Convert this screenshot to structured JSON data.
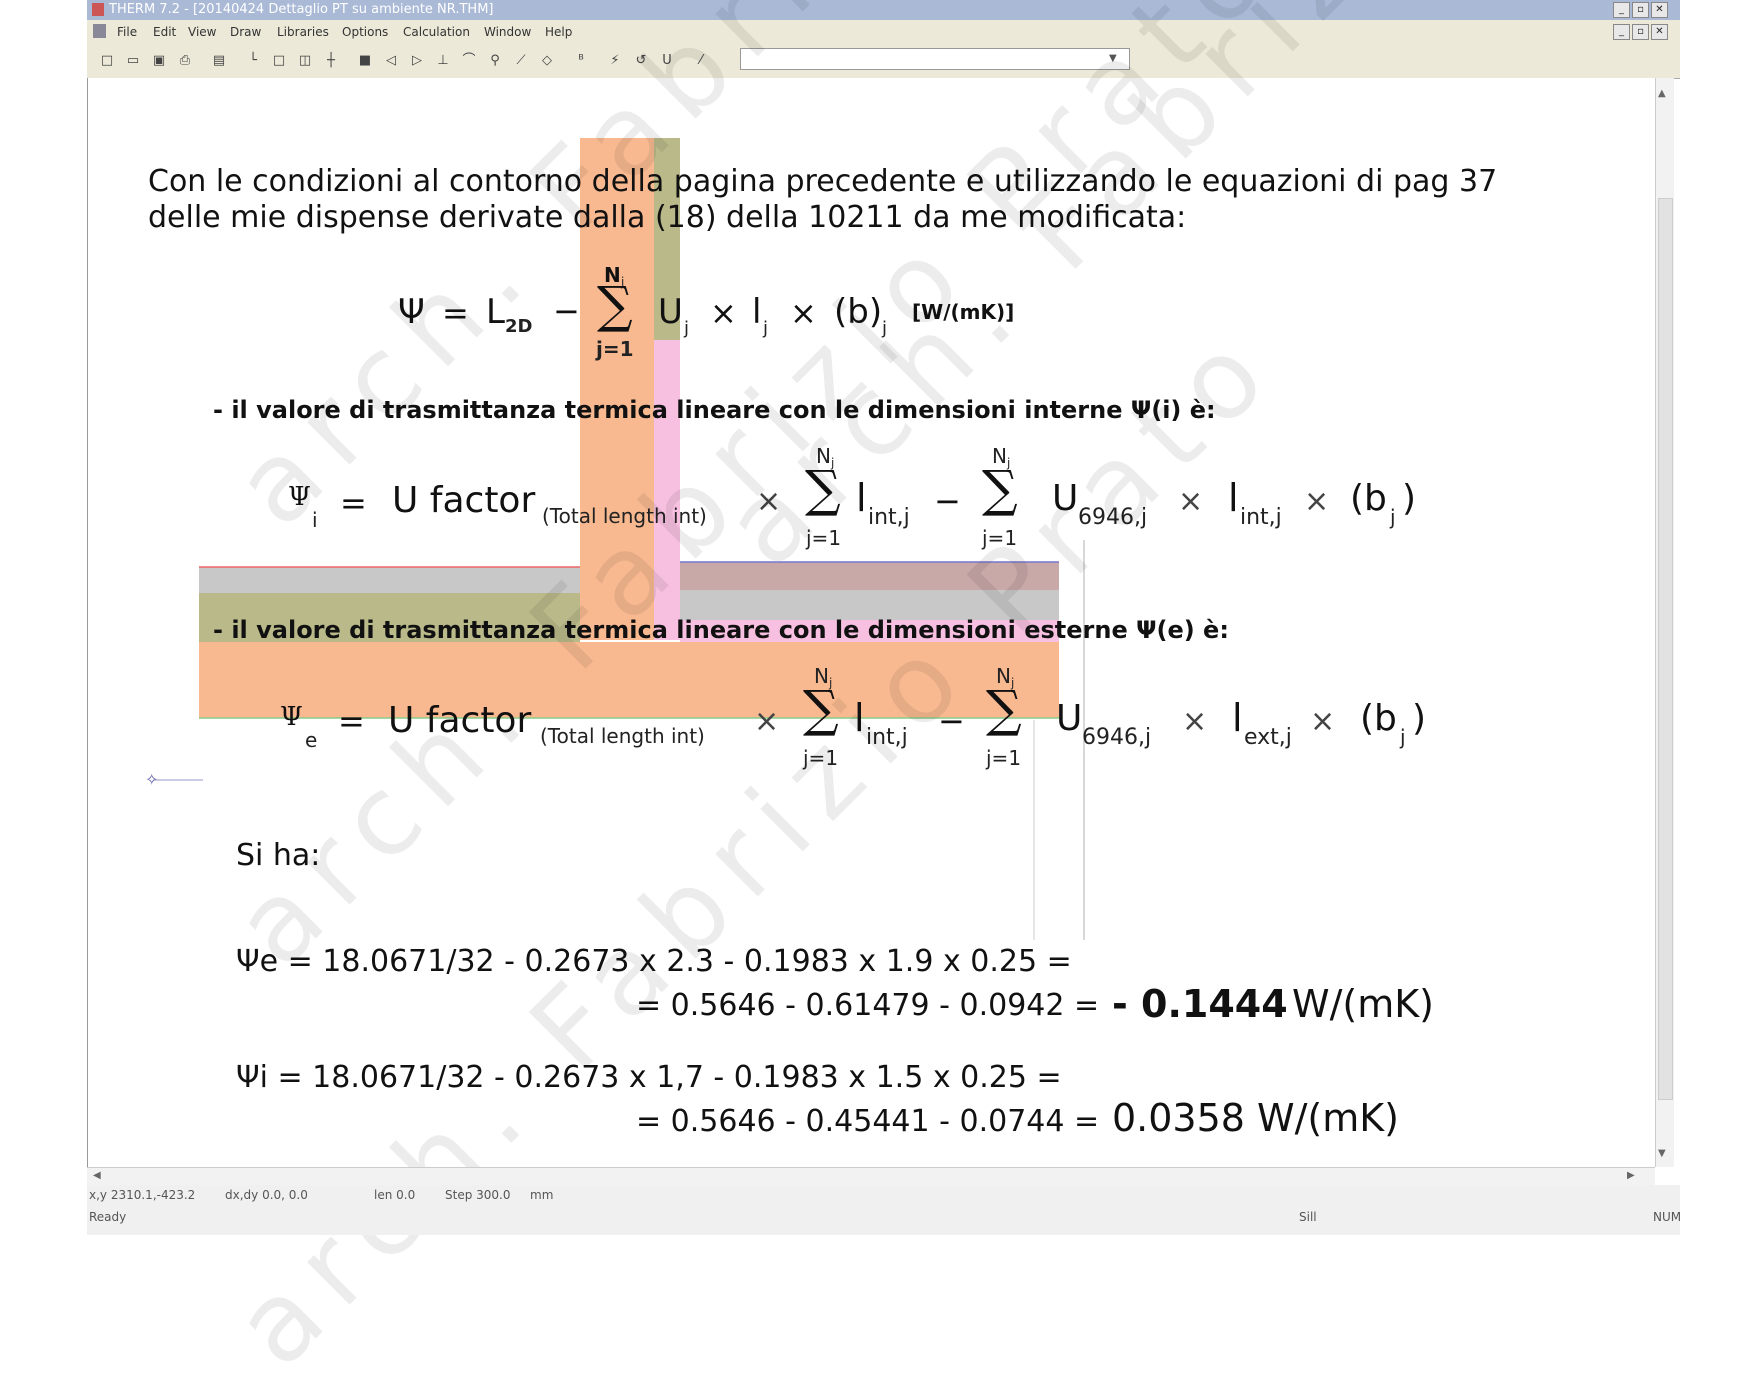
{
  "window": {
    "title": "THERM 7.2 - [20140424 Dettaglio PT su ambiente NR.THM]"
  },
  "menu": [
    "File",
    "Edit",
    "View",
    "Draw",
    "Libraries",
    "Options",
    "Calculation",
    "Window",
    "Help"
  ],
  "slide": {
    "intro_line1": "Con le condizioni al contorno della pagina precedente e utilizzando le equazioni di pag 37",
    "intro_line2": "delle mie dispense derivate dalla (18) della 10211 da me modificata:",
    "eq_main": {
      "psi": "Ψ",
      "eq": "=",
      "L": "L",
      "L_sub": "2D",
      "minus": "−",
      "sum_top": "N",
      "sum_top_sub": "j",
      "sum_bottom": "j=1",
      "term": "U",
      "term_sub": "j",
      "times": "×",
      "l": "l",
      "l_sub": "j",
      "b": "(b)",
      "b_sub": "j",
      "unit": "[W/(mK)]"
    },
    "internal_label": "- il valore di trasmittanza termica lineare con le dimensioni interne Ψ(i) è:",
    "eq_int": {
      "psi": "Ψ",
      "psi_sub": "i",
      "eq": "=",
      "ufactor": "U factor",
      "ufactor_sub": "(Total length int)",
      "times": "×",
      "sum1_top": "N",
      "sum1_top_sub": "j",
      "sum_bottom": "j=1",
      "l1": "l",
      "l1_sub": "int,j",
      "minus": "−",
      "U": "U",
      "U_sub": "6946,j",
      "l2": "l",
      "l2_sub": "int,j",
      "b": "(b",
      "b_sub": "j",
      "b_close": ")"
    },
    "external_label": "- il valore di trasmittanza termica lineare con le dimensioni esterne Ψ(e) è:",
    "eq_ext": {
      "psi": "Ψ",
      "psi_sub": "e",
      "eq": "=",
      "ufactor": "U factor",
      "ufactor_sub": "(Total length int)",
      "times": "×",
      "sum1_top": "N",
      "sum1_top_sub": "j",
      "sum_bottom": "j=1",
      "l1": "l",
      "l1_sub": "int,j",
      "minus": "−",
      "U": "U",
      "U_sub": "6946,j",
      "l2": "l",
      "l2_sub": "ext,j",
      "b": "(b",
      "b_sub": "j",
      "b_close": ")"
    },
    "si_ha": "Si ha:",
    "psi_e_line1": "Ψe = 18.0671/32 - 0.2673 x 2.3 - 0.1983 x 1.9 x 0.25 =",
    "psi_e_line2": "= 0.5646 - 0.61479 - 0.0942 =",
    "psi_e_result": "- 0.1444",
    "psi_e_unit": "W/(mK)",
    "psi_i_line1": "Ψi = 18.0671/32 - 0.2673 x 1,7 - 0.1983 x 1.5 x 0.25 =",
    "psi_i_line2": "= 0.5646 - 0.45441 - 0.0744 =",
    "psi_i_result": "0.0358 W/(mK)"
  },
  "watermark": "arch. Fabrizio Prato",
  "status": {
    "xy": "x,y 2310.1,-423.2",
    "dxdy": "dx,dy  0.0, 0.0",
    "len": "len  0.0",
    "step": "Step 300.0",
    "unit": "mm",
    "ready": "Ready",
    "sill": "Sill",
    "num": "NUM"
  },
  "colors": {
    "orange": "#f8b990",
    "olive": "#b9b98a",
    "grey": "#c8c8c8",
    "mauve": "#c9a8a8",
    "pink": "#f7c0e0"
  }
}
